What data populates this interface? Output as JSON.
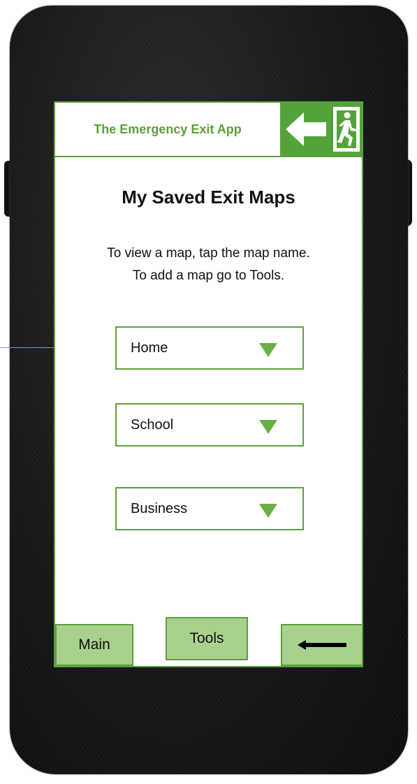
{
  "header": {
    "app_title": "The Emergency Exit App"
  },
  "page": {
    "title": "My Saved Exit Maps",
    "instruction_line1": "To view a map, tap the map name.",
    "instruction_line2": "To add a map go to Tools."
  },
  "maps": [
    {
      "label": "Home"
    },
    {
      "label": "School"
    },
    {
      "label": "Business"
    }
  ],
  "nav": {
    "main_label": "Main",
    "tools_label": "Tools",
    "back_icon": "left-arrow-icon"
  },
  "colors": {
    "accent_green": "#5aa13a",
    "button_fill": "#a9d18e",
    "dropdown_arrow": "#6aae46",
    "phone_body": "#161616"
  }
}
